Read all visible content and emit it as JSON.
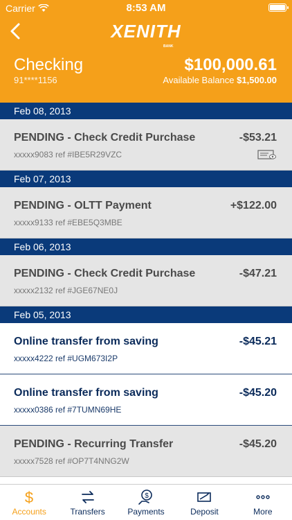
{
  "status": {
    "carrier": "Carrier",
    "time": "8:53 AM"
  },
  "header": {
    "logo": "XENITH",
    "logo_sub": "BANK",
    "account_name": "Checking",
    "account_number": "91****1156",
    "balance": "$100,000.61",
    "available_label": "Available Balance",
    "available_value": "$1,500.00"
  },
  "groups": [
    {
      "date": "Feb 08, 2013",
      "items": [
        {
          "desc": "PENDING - Check Credit Purchase",
          "ref": "xxxxx9083 ref #IBE5R29VZC",
          "amount": "-$53.21",
          "status": "pending",
          "has_check": true
        }
      ]
    },
    {
      "date": "Feb 07, 2013",
      "items": [
        {
          "desc": "PENDING - OLTT Payment",
          "ref": "xxxxx9133 ref #EBE5Q3MBE",
          "amount": "+$122.00",
          "status": "pending"
        }
      ]
    },
    {
      "date": "Feb 06, 2013",
      "items": [
        {
          "desc": "PENDING - Check Credit Purchase",
          "ref": "xxxxx2132 ref #JGE67NE0J",
          "amount": "-$47.21",
          "status": "pending"
        }
      ]
    },
    {
      "date": "Feb 05, 2013",
      "items": [
        {
          "desc": "Online transfer from saving",
          "ref": "xxxxx4222 ref #UGM673I2P",
          "amount": "-$45.21",
          "status": "posted"
        },
        {
          "desc": "Online transfer from saving",
          "ref": "xxxxx0386 ref #7TUMN69HE",
          "amount": "-$45.20",
          "status": "posted"
        },
        {
          "desc": "PENDING - Recurring Transfer",
          "ref": "xxxxx7528 ref #OP7T4NNG2W",
          "amount": "-$45.20",
          "status": "pending"
        }
      ]
    }
  ],
  "tabs": [
    {
      "label": "Accounts",
      "icon": "dollar-icon",
      "active": true
    },
    {
      "label": "Transfers",
      "icon": "transfer-icon"
    },
    {
      "label": "Payments",
      "icon": "payment-icon"
    },
    {
      "label": "Deposit",
      "icon": "deposit-icon"
    },
    {
      "label": "More",
      "icon": "more-icon"
    }
  ],
  "colors": {
    "brand": "#F5A01A",
    "navy": "#0A3A7A",
    "pending_bg": "#E5E5E5"
  }
}
